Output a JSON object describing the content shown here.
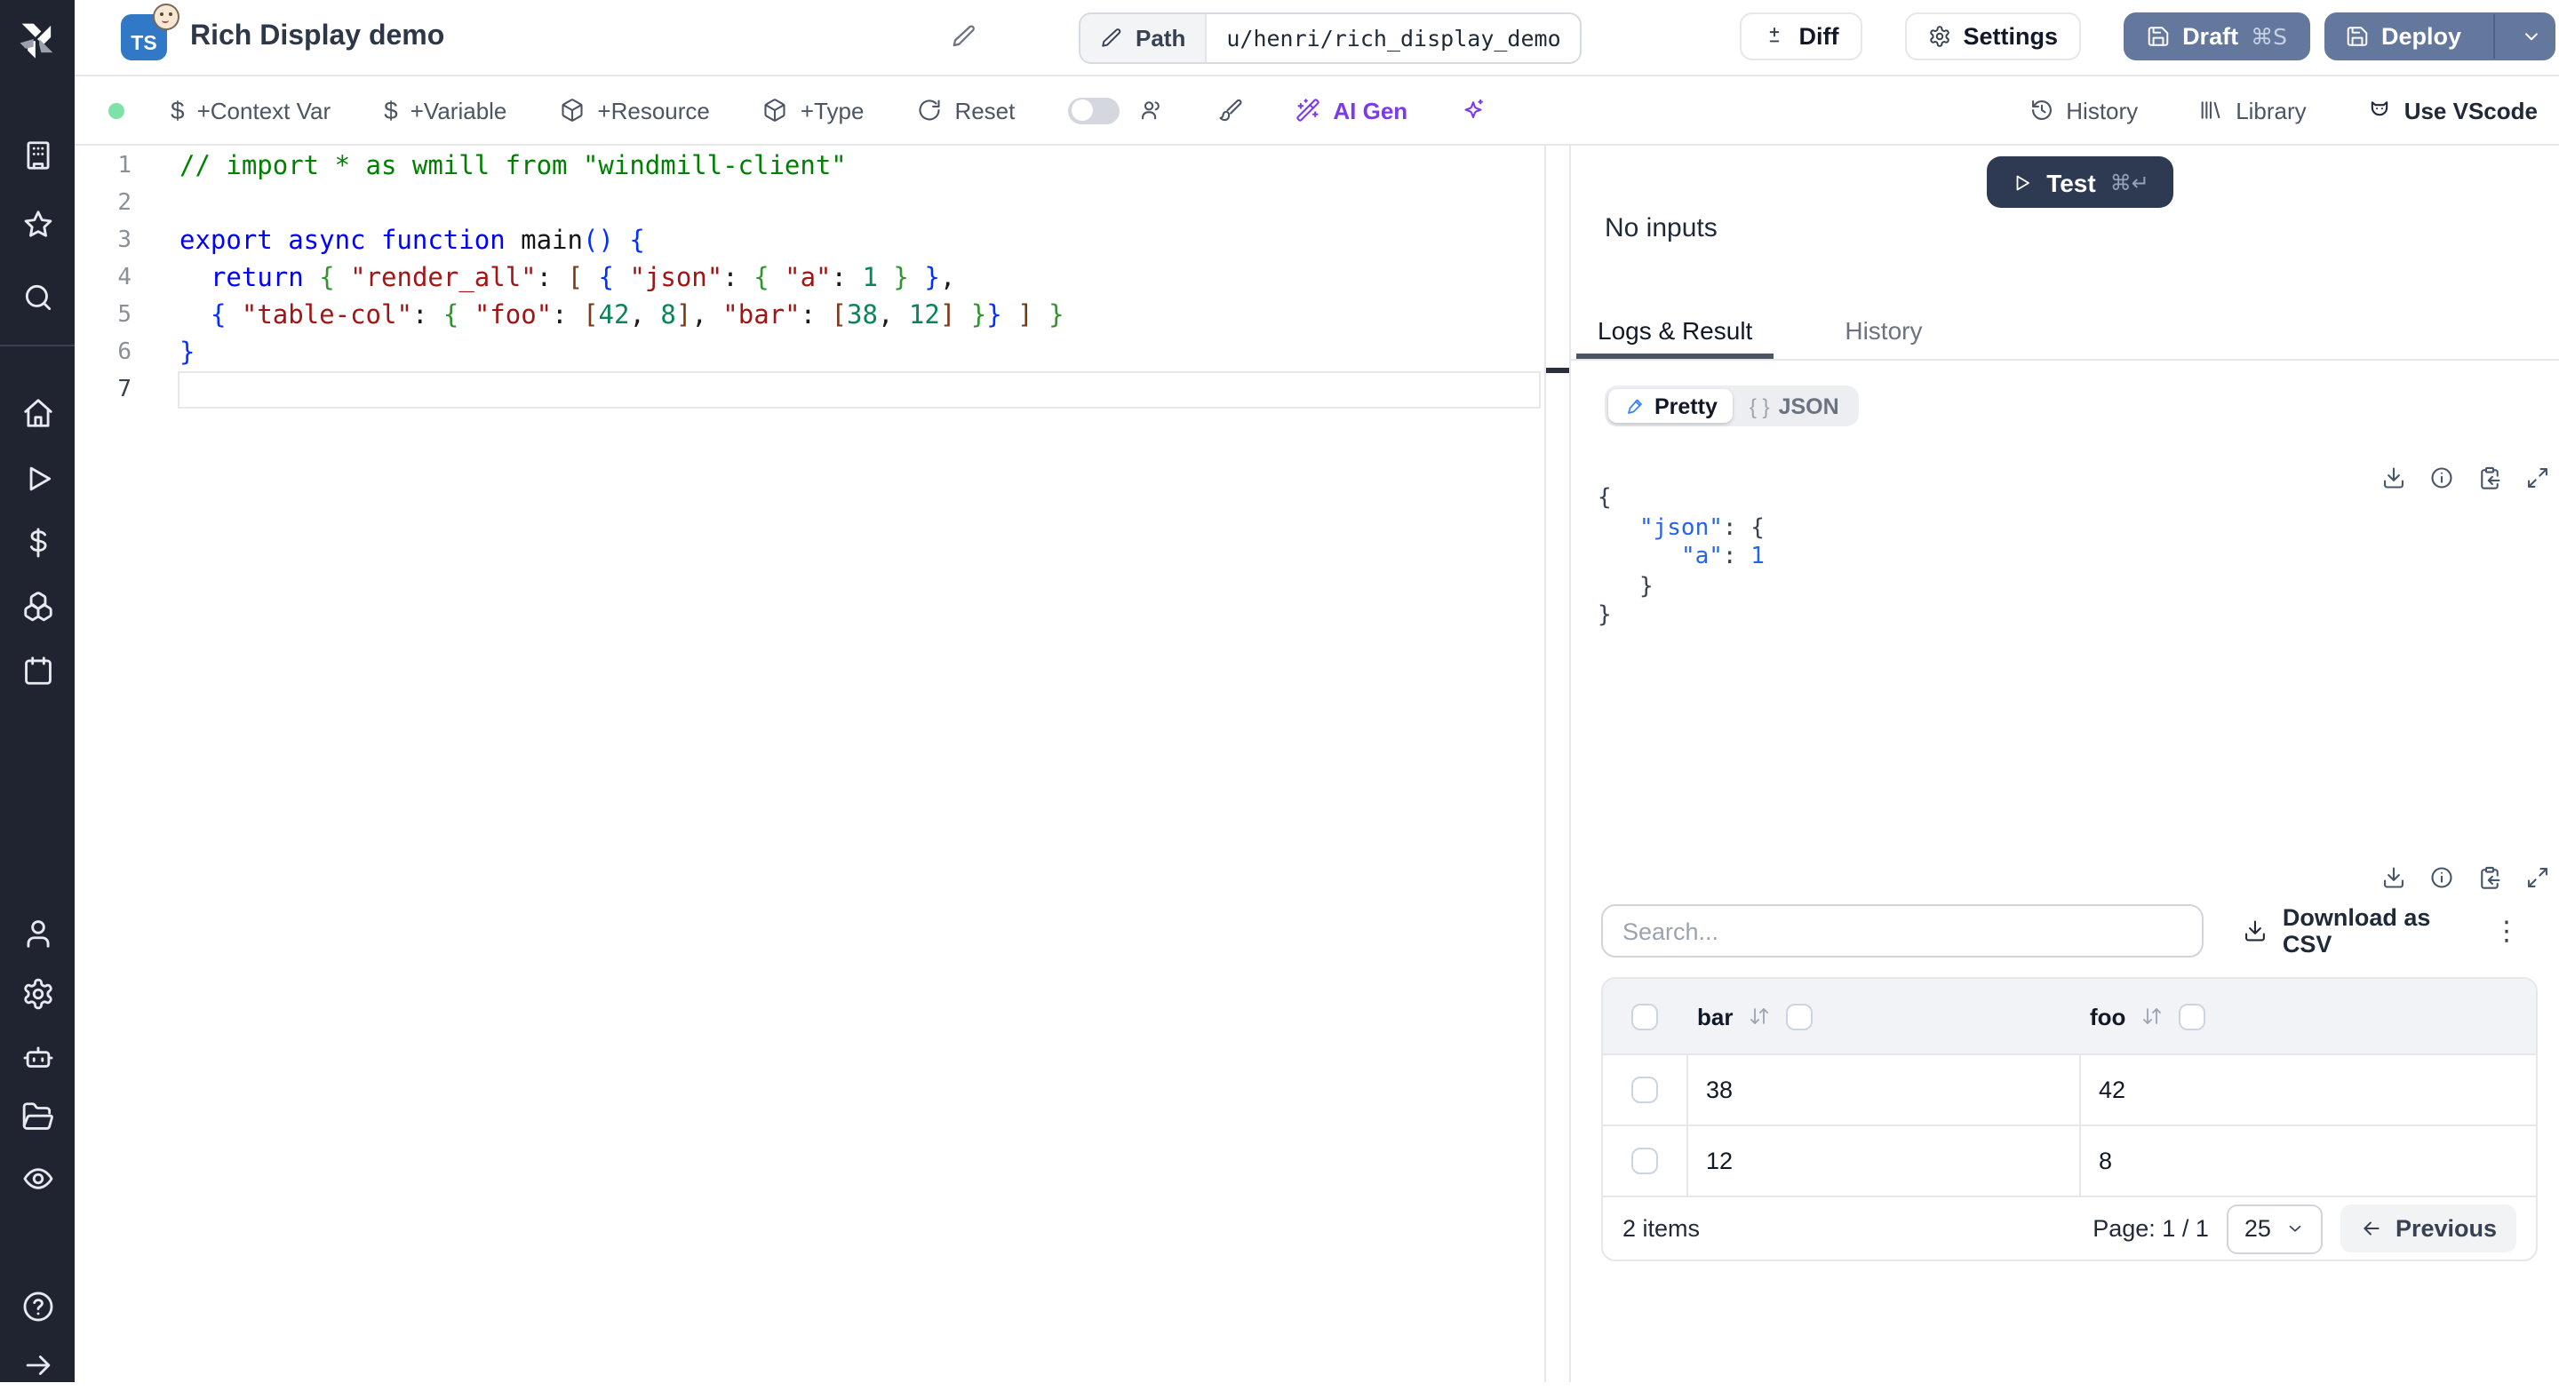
{
  "topbar": {
    "title": "Rich Display demo",
    "lang_badge": "TS",
    "path_label": "Path",
    "path_value": "u/henri/rich_display_demo",
    "diff_label": "Diff",
    "settings_label": "Settings",
    "draft_label": "Draft",
    "draft_kbd": "⌘S",
    "deploy_label": "Deploy"
  },
  "toolbar": {
    "context_var": "+Context Var",
    "variable": "+Variable",
    "resource": "+Resource",
    "type": "+Type",
    "reset": "Reset",
    "ai_gen": "AI Gen",
    "history": "History",
    "library": "Library",
    "vscode": "Use VScode",
    "dollar_glyph": "$"
  },
  "editor": {
    "active_line": 7,
    "lines": [
      {
        "tokens": [
          [
            "cmt",
            "// import * as wmill from \"windmill-client\""
          ]
        ]
      },
      {
        "tokens": []
      },
      {
        "tokens": [
          [
            "kw",
            "export async function "
          ],
          [
            "fn",
            "main"
          ],
          [
            "b1",
            "()"
          ],
          [
            "pl",
            " "
          ],
          [
            "b1",
            "{"
          ]
        ]
      },
      {
        "tokens": [
          [
            "pl",
            "  "
          ],
          [
            "kw",
            "return"
          ],
          [
            "pl",
            " "
          ],
          [
            "b2",
            "{"
          ],
          [
            "pl",
            " "
          ],
          [
            "str",
            "\"render_all\""
          ],
          [
            "pl",
            ": "
          ],
          [
            "b3",
            "["
          ],
          [
            "pl",
            " "
          ],
          [
            "b1",
            "{"
          ],
          [
            "pl",
            " "
          ],
          [
            "str",
            "\"json\""
          ],
          [
            "pl",
            ": "
          ],
          [
            "b2",
            "{"
          ],
          [
            "pl",
            " "
          ],
          [
            "str",
            "\"a\""
          ],
          [
            "pl",
            ": "
          ],
          [
            "num",
            "1"
          ],
          [
            "pl",
            " "
          ],
          [
            "b2",
            "}"
          ],
          [
            "pl",
            " "
          ],
          [
            "b1",
            "}"
          ],
          [
            "pl",
            ","
          ]
        ]
      },
      {
        "tokens": [
          [
            "pl",
            "  "
          ],
          [
            "b1",
            "{"
          ],
          [
            "pl",
            " "
          ],
          [
            "str",
            "\"table-col\""
          ],
          [
            "pl",
            ": "
          ],
          [
            "b2",
            "{"
          ],
          [
            "pl",
            " "
          ],
          [
            "str",
            "\"foo\""
          ],
          [
            "pl",
            ": "
          ],
          [
            "b3",
            "["
          ],
          [
            "num",
            "42"
          ],
          [
            "pl",
            ", "
          ],
          [
            "num",
            "8"
          ],
          [
            "b3",
            "]"
          ],
          [
            "pl",
            ", "
          ],
          [
            "str",
            "\"bar\""
          ],
          [
            "pl",
            ": "
          ],
          [
            "b3",
            "["
          ],
          [
            "num",
            "38"
          ],
          [
            "pl",
            ", "
          ],
          [
            "num",
            "12"
          ],
          [
            "b3",
            "]"
          ],
          [
            "pl",
            " "
          ],
          [
            "b2",
            "}"
          ],
          [
            "b1",
            "}"
          ],
          [
            "pl",
            " "
          ],
          [
            "b3",
            "]"
          ],
          [
            "pl",
            " "
          ],
          [
            "b2",
            "}"
          ]
        ]
      },
      {
        "tokens": [
          [
            "b1",
            "}"
          ]
        ]
      },
      {
        "tokens": []
      }
    ]
  },
  "panel": {
    "test_label": "Test",
    "test_kbd": "⌘↵",
    "no_inputs": "No inputs",
    "tab_logs": "Logs & Result",
    "tab_history": "History",
    "pretty_label": "Pretty",
    "json_glyph": "{ }",
    "json_label": "JSON",
    "result_lines": [
      [
        [
          "rb",
          "{"
        ]
      ],
      [
        [
          "rp",
          "   "
        ],
        [
          "rk",
          "\"json\""
        ],
        [
          "rp",
          ": "
        ],
        [
          "rb",
          "{"
        ]
      ],
      [
        [
          "rp",
          "      "
        ],
        [
          "rk",
          "\"a\""
        ],
        [
          "rp",
          ": "
        ],
        [
          "rv",
          "1"
        ]
      ],
      [
        [
          "rp",
          "   "
        ],
        [
          "rb",
          "}"
        ]
      ],
      [
        [
          "rb",
          "}"
        ]
      ]
    ],
    "search_placeholder": "Search...",
    "download_csv": "Download as CSV",
    "kebab_glyph": "⋮",
    "table": {
      "columns": [
        "bar",
        "foo"
      ],
      "rows": [
        [
          "38",
          "42"
        ],
        [
          "12",
          "8"
        ]
      ],
      "items_label": "2 items",
      "page_label": "Page: 1 / 1",
      "page_size": "25",
      "previous_label": "Previous"
    }
  },
  "colors": {
    "accent_slate": "#64789e",
    "test_navy": "#2e3a52",
    "ai_purple": "#7c3aed",
    "status_green": "#7ee2a8"
  }
}
